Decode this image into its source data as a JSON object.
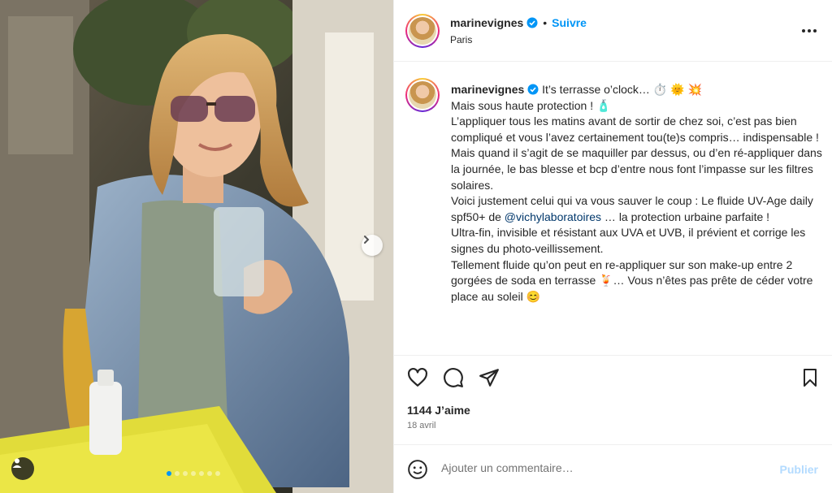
{
  "post": {
    "username": "marinevignes",
    "follow_label": "Suivre",
    "separator": "•",
    "location": "Paris",
    "caption": " It’s terrasse o’clock… ⏱️ 🌞 💥\nMais sous haute protection ! 🧴\nL’appliquer tous les matins avant de sortir de chez soi, c’est pas bien compliqué et vous l’avez certainement tou(te)s compris… indispensable !\nMais quand il s’agit de se maquiller par dessus, ou d’en ré-appliquer dans la journée, le bas blesse et bcp d’entre nous font l’impasse sur les filtres solaires.\nVoici justement celui qui va vous sauver le coup : Le fluide UV-Age daily spf50+ de ",
    "mention": "@vichylaboratoires",
    "caption_end": " … la protection urbaine parfaite !\nUltra-fin, invisible et résistant aux UVA et UVB, il prévient et corrige les signes du photo-veillissement.\nTellement fluide qu’on peut en re-appliquer sur son make-up entre 2 gorgées de soda en terrasse 🍹… Vous n’êtes pas prête de céder votre place au soleil 😊",
    "likes": "1144 J’aime",
    "date": "18 avril"
  },
  "comment": {
    "placeholder": "Ajouter un commentaire…",
    "publish_label": "Publier"
  },
  "carousel": {
    "slides": 7,
    "active_index": 0
  },
  "icons": {
    "like": "heart-icon",
    "comment": "comment-icon",
    "share": "send-icon",
    "save": "bookmark-icon",
    "emoji": "emoji-icon",
    "next": "chevron-right-icon",
    "tag": "user-tag-icon",
    "verified": "verified-badge-icon",
    "more": "more-options-icon"
  },
  "colors": {
    "accent": "#0095f6",
    "mention": "#00376b",
    "publish_disabled": "#b3dbff",
    "muted": "#737373"
  }
}
